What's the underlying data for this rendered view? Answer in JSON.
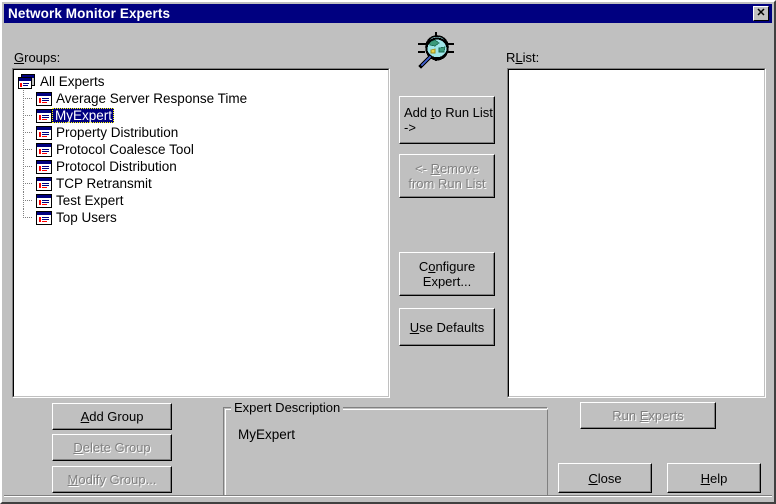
{
  "window": {
    "title": "Network Monitor Experts",
    "close_glyph": "✕",
    "colors": {
      "titlebar": "#000080",
      "face": "#c0c0c0",
      "highlight": "#000080",
      "disabled_text": "#808080"
    }
  },
  "groups_panel": {
    "label_accel": "G",
    "label_rest": "roups:",
    "tree": {
      "root": "All Experts",
      "items": [
        {
          "label": "Average Server Response Time",
          "selected": false
        },
        {
          "label": "MyExpert",
          "selected": true
        },
        {
          "label": "Property Distribution",
          "selected": false
        },
        {
          "label": "Protocol Coalesce Tool",
          "selected": false
        },
        {
          "label": "Protocol Distribution",
          "selected": false
        },
        {
          "label": "TCP Retransmit",
          "selected": false
        },
        {
          "label": "Test Expert",
          "selected": false
        },
        {
          "label": "Top Users",
          "selected": false
        }
      ]
    }
  },
  "runlist_panel": {
    "label_pre": "R",
    "label_accel": "L",
    "label_post": "ist:",
    "items": []
  },
  "center_buttons": {
    "add_to_run_list": {
      "pre": "Add ",
      "accel": "t",
      "post": "o Run List",
      "line2": "->",
      "enabled": true
    },
    "remove_from_run_list": {
      "pre": "<- ",
      "accel": "R",
      "post": "emove",
      "line2": "from Run List",
      "enabled": false
    },
    "configure_expert": {
      "pre": "C",
      "accel": "o",
      "post": "nfigure",
      "line2": "Expert...",
      "enabled": true
    },
    "use_defaults": {
      "accel": "U",
      "post": "se Defaults",
      "enabled": true
    }
  },
  "group_buttons": {
    "add_group": {
      "accel": "A",
      "post": "dd Group",
      "enabled": true
    },
    "delete_group": {
      "accel": "D",
      "post": "elete Group",
      "enabled": false
    },
    "modify_group": {
      "accel": "M",
      "post": "odify Group...",
      "enabled": false
    }
  },
  "expert_description": {
    "legend": "Expert Description",
    "text": "MyExpert"
  },
  "action_buttons": {
    "run_experts": {
      "pre": "Run ",
      "accel": "E",
      "post": "xperts",
      "enabled": false
    },
    "close": {
      "accel": "C",
      "post": "lose",
      "enabled": true
    },
    "help": {
      "accel": "H",
      "post": "elp",
      "enabled": true
    }
  },
  "icons": {
    "magnifier": "magnifier-network-icon",
    "tree_root": "experts-folder-icon",
    "tree_node": "expert-window-icon",
    "close": "close-icon"
  }
}
